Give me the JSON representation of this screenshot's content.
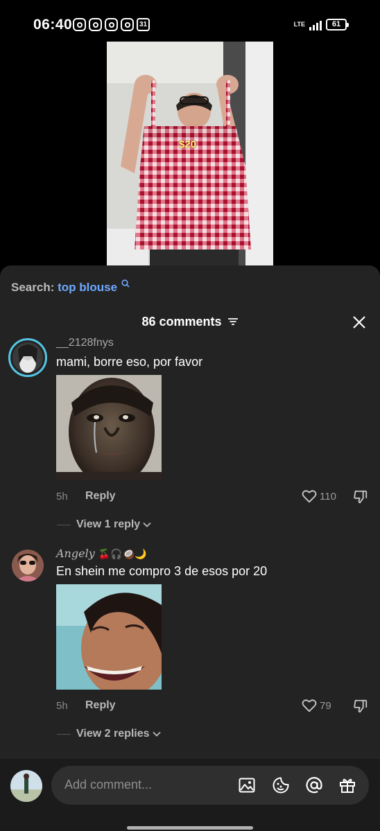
{
  "status_bar": {
    "time": "06:40",
    "app_icons": [
      "instagram-icon",
      "instagram-icon",
      "instagram-icon",
      "instagram-icon"
    ],
    "calendar_day": "31",
    "network": "LTE",
    "battery": "61"
  },
  "video": {
    "price_overlay": "$20"
  },
  "search": {
    "prefix": "Search:",
    "term": "top blouse"
  },
  "comments_header": {
    "count_label": "86 comments"
  },
  "comments": [
    {
      "username": "__2128fnys",
      "text": "mami, borre eso, por favor",
      "time": "5h",
      "reply_label": "Reply",
      "likes": "110",
      "view_replies": "View 1 reply"
    },
    {
      "username": "Angely",
      "username_emojis": "🍒🎧🥥🌙",
      "text": "En shein me compro 3 de esos por 20",
      "time": "5h",
      "reply_label": "Reply",
      "likes": "79",
      "view_replies": "View 2 replies"
    }
  ],
  "composer": {
    "placeholder": "Add comment..."
  },
  "colors": {
    "sheet_bg": "#232323",
    "search_term": "#6fa8ff",
    "avatar_ring": "#56c6e6"
  }
}
